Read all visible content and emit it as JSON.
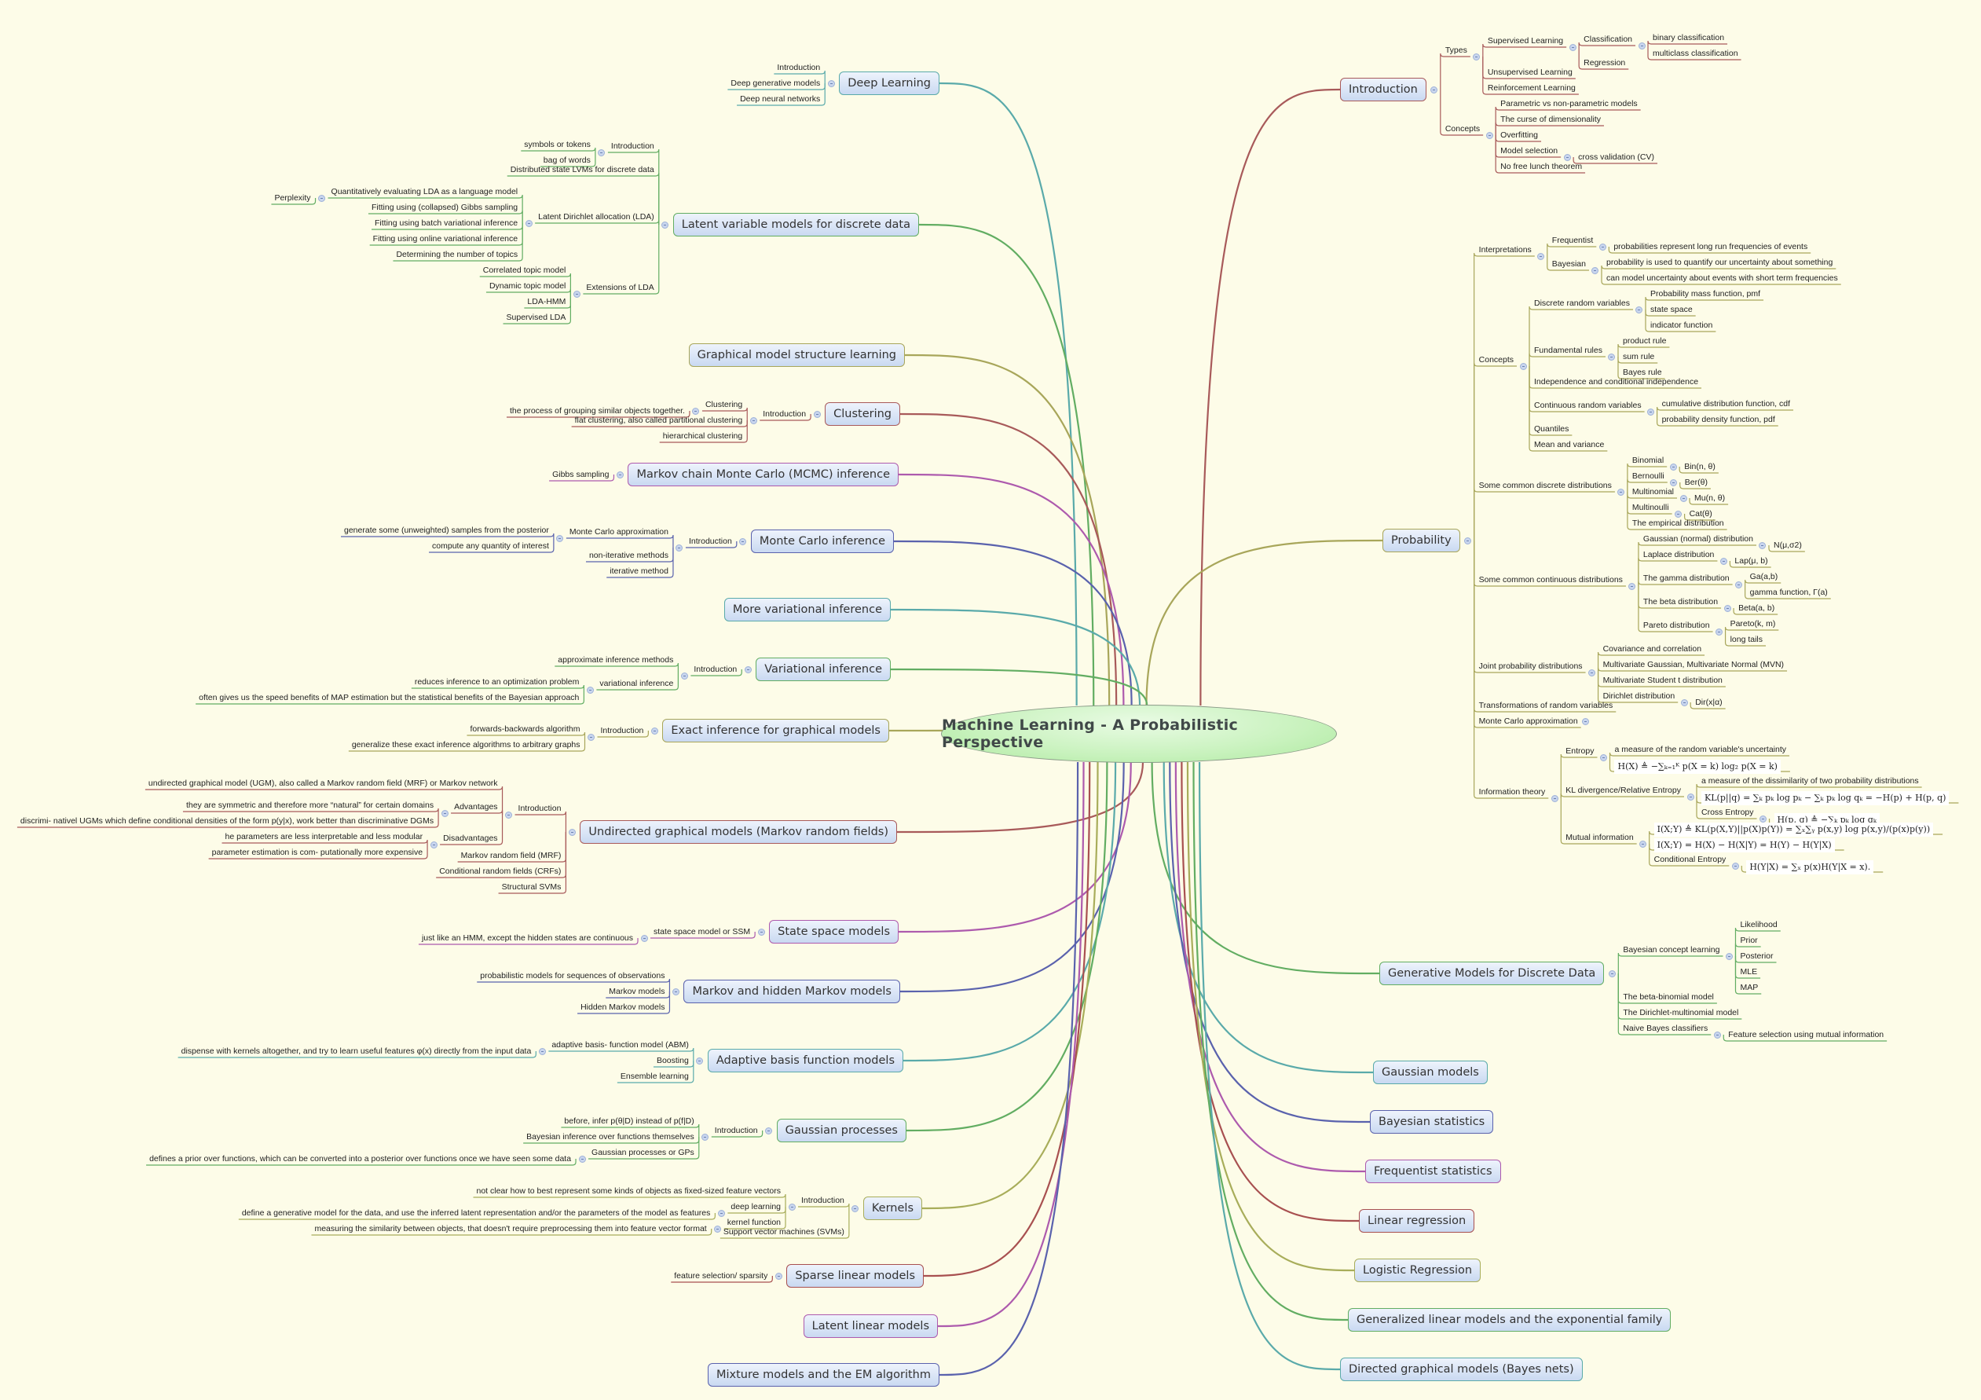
{
  "title": "Machine Learning - A Probabilistic Perspective",
  "colors": {
    "red": "#a85a5a",
    "olive": "#a8a65a",
    "green": "#62ad62",
    "teal": "#5aaaaa",
    "blue": "#5a62ad",
    "purple": "#ad5aad",
    "darkred": "#a85050",
    "yellowgreen": "#a8ad5a"
  },
  "right": [
    {
      "label": "Introduction",
      "color": "red",
      "children": [
        {
          "label": "Types",
          "children": [
            {
              "label": "Supervised Learning",
              "children": [
                {
                  "label": "Classification",
                  "children": [
                    {
                      "label": "binary classification"
                    },
                    {
                      "label": "multiclass classification"
                    }
                  ]
                },
                {
                  "label": "Regression"
                }
              ]
            },
            {
              "label": "Unsupervised Learning"
            },
            {
              "label": "Reinforcement Learning"
            }
          ]
        },
        {
          "label": "Concepts",
          "children": [
            {
              "label": "Parametric vs non-parametric models"
            },
            {
              "label": "The curse of dimensionality"
            },
            {
              "label": "Overfitting"
            },
            {
              "label": "Model selection",
              "children": [
                {
                  "label": "cross validation (CV)"
                }
              ]
            },
            {
              "label": "No free lunch theorem"
            }
          ]
        }
      ]
    },
    {
      "label": "Probability",
      "color": "olive",
      "children": [
        {
          "label": "Interpretations",
          "children": [
            {
              "label": "Frequentist",
              "children": [
                {
                  "label": "probabilities represent long run frequencies of events"
                }
              ]
            },
            {
              "label": "Bayesian",
              "children": [
                {
                  "label": "probability is used to quantify our uncertainty about something"
                },
                {
                  "label": "can model uncertainty about events with short term frequencies"
                }
              ]
            }
          ]
        },
        {
          "label": "Concepts",
          "children": [
            {
              "label": "Discrete random variables",
              "children": [
                {
                  "label": "Probability mass function, pmf"
                },
                {
                  "label": "state space"
                },
                {
                  "label": "indicator function"
                }
              ]
            },
            {
              "label": "Fundamental rules",
              "children": [
                {
                  "label": "product rule"
                },
                {
                  "label": "sum rule"
                },
                {
                  "label": "Bayes rule"
                }
              ]
            },
            {
              "label": "Independence and conditional independence"
            },
            {
              "label": "Continuous random variables",
              "children": [
                {
                  "label": "cumulative distribution function, cdf"
                },
                {
                  "label": "probability density function, pdf"
                }
              ]
            },
            {
              "label": "Quantiles"
            },
            {
              "label": "Mean and variance"
            }
          ]
        },
        {
          "label": "Some common discrete distributions",
          "children": [
            {
              "label": "Binomial",
              "children": [
                {
                  "label": "Bin(n, θ)"
                }
              ]
            },
            {
              "label": "Bernoulli",
              "children": [
                {
                  "label": "Ber(θ)"
                }
              ]
            },
            {
              "label": "Multinomial",
              "children": [
                {
                  "label": "Mu(n, θ)"
                }
              ]
            },
            {
              "label": "Multinoulli",
              "children": [
                {
                  "label": "Cat(θ)"
                }
              ]
            },
            {
              "label": "The empirical distribution"
            }
          ]
        },
        {
          "label": "Some common continuous distributions",
          "children": [
            {
              "label": "Gaussian (normal) distribution",
              "children": [
                {
                  "label": "N(μ,σ2)"
                }
              ]
            },
            {
              "label": "Laplace distribution",
              "children": [
                {
                  "label": "Lap(μ, b)"
                }
              ]
            },
            {
              "label": "The gamma distribution",
              "children": [
                {
                  "label": "Ga(a,b)"
                },
                {
                  "label": "gamma function, Γ(a)"
                }
              ]
            },
            {
              "label": "The beta distribution",
              "children": [
                {
                  "label": "Beta(a, b)"
                }
              ]
            },
            {
              "label": "Pareto distribution",
              "children": [
                {
                  "label": "Pareto(k, m)"
                },
                {
                  "label": "long tails"
                }
              ]
            }
          ]
        },
        {
          "label": "Joint probability distributions",
          "children": [
            {
              "label": "Covariance and correlation"
            },
            {
              "label": "Multivariate Gaussian, Multivariate Normal (MVN)"
            },
            {
              "label": "Multivariate Student t distribution"
            },
            {
              "label": "Dirichlet distribution",
              "children": [
                {
                  "label": "Dir(x|α)"
                }
              ]
            }
          ]
        },
        {
          "label": "Transformations of random variables"
        },
        {
          "label": "Monte Carlo approximation",
          "collapsed": true
        },
        {
          "label": "Information theory",
          "children": [
            {
              "label": "Entropy",
              "children": [
                {
                  "label": "a measure of the random variable's uncertainty"
                },
                {
                  "label": "H(X) ≜ −∑ₖ₌₁ᴷ p(X = k) log₂ p(X = k)",
                  "formula": true
                }
              ]
            },
            {
              "label": "KL divergence/Relative Entropy",
              "children": [
                {
                  "label": "a measure of the dissimilarity of two probability distributions"
                },
                {
                  "label": "KL(p||q) = ∑ₖ pₖ log pₖ − ∑ₖ pₖ log qₖ = −H(p) + H(p, q)",
                  "formula": true
                },
                {
                  "label": "Cross Entropy",
                  "children": [
                    {
                      "label": "H(p, q) ≜ −∑ₖ pₖ log qₖ",
                      "formula": true
                    }
                  ]
                }
              ]
            },
            {
              "label": "Mutual information",
              "children": [
                {
                  "label": "I(X;Y) ≜ KL(p(X,Y)||p(X)p(Y)) = ∑ₓ∑ᵧ p(x,y) log p(x,y)/(p(x)p(y))",
                  "formula": true
                },
                {
                  "label": "I(X;Y) = H(X) − H(X|Y) = H(Y) − H(Y|X)",
                  "formula": true
                },
                {
                  "label": "Conditional Entropy",
                  "children": [
                    {
                      "label": "H(Y|X) = ∑ₓ p(x)H(Y|X = x).",
                      "formula": true
                    }
                  ]
                }
              ]
            }
          ]
        }
      ]
    },
    {
      "label": "Generative Models for Discrete Data",
      "color": "green",
      "children": [
        {
          "label": "Bayesian concept learning",
          "children": [
            {
              "label": "Likelihood"
            },
            {
              "label": "Prior"
            },
            {
              "label": "Posterior"
            },
            {
              "label": "MLE"
            },
            {
              "label": "MAP"
            }
          ]
        },
        {
          "label": "The beta-binomial model"
        },
        {
          "label": "The Dirichlet-multinomial model"
        },
        {
          "label": "Naive Bayes classifiers",
          "children": [
            {
              "label": "Feature selection using mutual information"
            }
          ]
        }
      ]
    },
    {
      "label": "Gaussian models",
      "color": "teal"
    },
    {
      "label": "Bayesian statistics",
      "color": "blue"
    },
    {
      "label": "Frequentist statistics",
      "color": "purple"
    },
    {
      "label": "Linear regression",
      "color": "darkred"
    },
    {
      "label": "Logistic Regression",
      "color": "yellowgreen"
    },
    {
      "label": "Generalized linear models and the exponential family",
      "color": "green"
    },
    {
      "label": "Directed graphical models (Bayes nets)",
      "color": "teal"
    }
  ],
  "left": [
    {
      "label": "Deep Learning",
      "color": "teal",
      "children": [
        {
          "label": "Introduction"
        },
        {
          "label": "Deep generative models"
        },
        {
          "label": "Deep neural networks"
        }
      ]
    },
    {
      "label": "Latent variable models for discrete data",
      "color": "green",
      "children": [
        {
          "label": "Introduction",
          "children": [
            {
              "label": "symbols or tokens"
            },
            {
              "label": "bag of words"
            }
          ]
        },
        {
          "label": "Distributed state LVMs for discrete data"
        },
        {
          "label": "Latent Dirichlet allocation (LDA)",
          "children": [
            {
              "label": "Quantitatively evaluating LDA as a language model",
              "children": [
                {
                  "label": "Perplexity"
                }
              ]
            },
            {
              "label": "Fitting using (collapsed) Gibbs sampling"
            },
            {
              "label": "Fitting using batch variational inference"
            },
            {
              "label": "Fitting using online variational inference"
            },
            {
              "label": "Determining the number of topics"
            }
          ]
        },
        {
          "label": "Extensions of LDA",
          "children": [
            {
              "label": "Correlated topic model"
            },
            {
              "label": "Dynamic topic model"
            },
            {
              "label": "LDA-HMM"
            },
            {
              "label": "Supervised LDA"
            }
          ]
        }
      ]
    },
    {
      "label": "Graphical model structure learning",
      "color": "olive"
    },
    {
      "label": "Clustering",
      "color": "red",
      "children": [
        {
          "label": "Introduction",
          "children": [
            {
              "label": "Clustering",
              "children": [
                {
                  "label": "the process of grouping similar objects together."
                }
              ]
            },
            {
              "label": "flat clustering, also called partitional clustering"
            },
            {
              "label": "hierarchical clustering"
            }
          ]
        }
      ]
    },
    {
      "label": "Markov chain Monte Carlo (MCMC) inference",
      "color": "purple",
      "children": [
        {
          "label": "Gibbs sampling"
        }
      ]
    },
    {
      "label": "Monte Carlo inference",
      "color": "blue",
      "children": [
        {
          "label": "Introduction",
          "children": [
            {
              "label": "Monte Carlo approximation",
              "children": [
                {
                  "label": "generate some (unweighted) samples from the posterior"
                },
                {
                  "label": "compute any quantity of interest"
                }
              ]
            },
            {
              "label": "non-iterative methods"
            },
            {
              "label": "iterative method"
            }
          ]
        }
      ]
    },
    {
      "label": "More variational inference",
      "color": "teal"
    },
    {
      "label": "Variational inference",
      "color": "green",
      "children": [
        {
          "label": "Introduction",
          "children": [
            {
              "label": "approximate inference methods"
            },
            {
              "label": "variational inference",
              "children": [
                {
                  "label": "reduces inference to an optimization problem"
                },
                {
                  "label": "often gives us the speed benefits of MAP estimation but the statistical benefits of the Bayesian approach"
                }
              ]
            }
          ]
        }
      ]
    },
    {
      "label": "Exact inference for graphical models",
      "color": "olive",
      "children": [
        {
          "label": "Introduction",
          "children": [
            {
              "label": "forwards-backwards algorithm"
            },
            {
              "label": "generalize these exact inference algorithms to arbitrary graphs"
            }
          ]
        }
      ]
    },
    {
      "label": "Undirected graphical models (Markov random fields)",
      "color": "red",
      "children": [
        {
          "label": "Introduction",
          "children": [
            {
              "label": "undirected graphical model (UGM), also called a Markov random field (MRF) or Markov network"
            },
            {
              "label": "Advantages",
              "children": [
                {
                  "label": "they are symmetric and therefore more “natural” for certain domains"
                },
                {
                  "label": "discrimi- nativel UGMs which define conditional densities of the form p(y|x), work better than discriminative DGMs"
                }
              ]
            },
            {
              "label": "Disadvantages",
              "children": [
                {
                  "label": "he parameters are less interpretable and less modular"
                },
                {
                  "label": "parameter estimation is com- putationally more expensive"
                }
              ]
            }
          ]
        },
        {
          "label": "Markov random field (MRF)"
        },
        {
          "label": "Conditional random fields (CRFs)"
        },
        {
          "label": "Structural SVMs"
        }
      ]
    },
    {
      "label": "State space models",
      "color": "purple",
      "children": [
        {
          "label": "state space model or SSM",
          "children": [
            {
              "label": "just like an HMM, except the hidden states are continuous"
            }
          ]
        }
      ]
    },
    {
      "label": "Markov and hidden Markov models",
      "color": "blue",
      "children": [
        {
          "label": "probabilistic models for sequences of observations"
        },
        {
          "label": "Markov models"
        },
        {
          "label": "Hidden Markov models"
        }
      ]
    },
    {
      "label": "Adaptive basis function models",
      "color": "teal",
      "children": [
        {
          "label": "adaptive basis- function model (ABM)",
          "children": [
            {
              "label": "dispense with kernels altogether, and try to learn useful features φ(x) directly from the input data"
            }
          ]
        },
        {
          "label": "Boosting"
        },
        {
          "label": "Ensemble learning"
        }
      ]
    },
    {
      "label": "Gaussian processes",
      "color": "green",
      "children": [
        {
          "label": "Introduction",
          "children": [
            {
              "label": "before, infer p(θ|D) instead of p(f|D)"
            },
            {
              "label": "Bayesian inference over functions themselves"
            },
            {
              "label": "Gaussian processes or GPs",
              "children": [
                {
                  "label": "defines a prior over functions, which can be converted into a posterior over functions once we have seen some data"
                }
              ]
            }
          ]
        }
      ]
    },
    {
      "label": "Kernels",
      "color": "yellowgreen",
      "children": [
        {
          "label": "Introduction",
          "children": [
            {
              "label": "not clear how to best represent some kinds of objects as fixed-sized feature vectors"
            },
            {
              "label": "deep learning",
              "children": [
                {
                  "label": "define a generative model for the data, and use the inferred latent representation and/or the parameters of the model as features"
                }
              ]
            },
            {
              "label": "kernel function",
              "children": [
                {
                  "label": "measuring the similarity between objects, that doesn't require preprocessing them into feature vector format"
                }
              ]
            }
          ]
        },
        {
          "label": "Support vector machines (SVMs)"
        }
      ]
    },
    {
      "label": "Sparse linear models",
      "color": "darkred",
      "children": [
        {
          "label": "feature selection/ sparsity"
        }
      ]
    },
    {
      "label": "Latent linear models",
      "color": "purple"
    },
    {
      "label": "Mixture models and the EM algorithm",
      "color": "blue"
    }
  ]
}
